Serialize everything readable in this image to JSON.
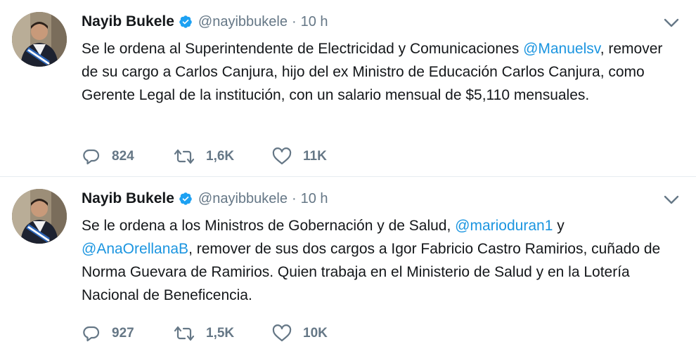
{
  "colors": {
    "mention": "#1b95e0",
    "secondary_text": "#657786",
    "verified": "#1da1f2",
    "divider": "#e6ecf0"
  },
  "icons": [
    "reply-icon",
    "retweet-icon",
    "like-icon",
    "verified-icon",
    "chevron-down-icon"
  ],
  "tweets": [
    {
      "author_name": "Nayib Bukele",
      "handle": "@nayibbukele",
      "separator": "·",
      "time": "10 h",
      "text_part1": "Se le ordena al Superintendente de Electricidad y Comunicaciones ",
      "mention1": "@Manuelsv",
      "text_part2": ", remover de su cargo a Carlos Canjura, hijo del ex Ministro de Educación Carlos Canjura, como Gerente Legal de la institución, con un salario mensual de $5,110 mensuales.",
      "replies": "824",
      "retweets": "1,6K",
      "likes": "11K"
    },
    {
      "author_name": "Nayib Bukele",
      "handle": "@nayibbukele",
      "separator": "·",
      "time": "10 h",
      "text_part1": "Se le ordena a los Ministros de Gobernación y de Salud, ",
      "mention1": "@marioduran1",
      "text_part2": " y ",
      "mention2": "@AnaOrellanaB",
      "text_part3": ", remover de sus dos cargos a Igor Fabricio Castro Ramirios, cuñado de Norma Guevara de Ramirios. Quien trabaja en el Ministerio de Salud y en la Lotería Nacional de Beneficencia.",
      "replies": "927",
      "retweets": "1,5K",
      "likes": "10K"
    }
  ]
}
